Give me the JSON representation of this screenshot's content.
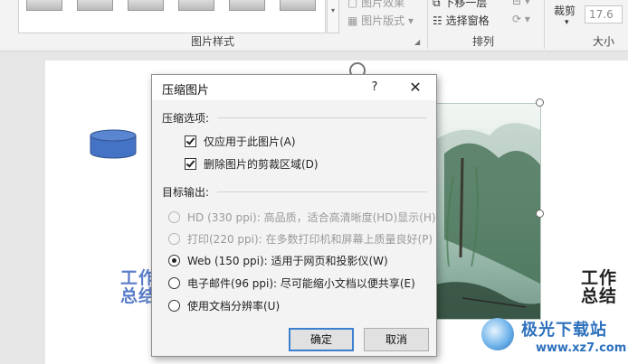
{
  "ribbon": {
    "picture_effects_label": "图片效果",
    "picture_layout_label": "图片版式",
    "bring_forward_label": "下移一层",
    "selection_pane_label": "选择窗格",
    "crop_label": "裁剪",
    "width_value": "17.6",
    "groups": {
      "picture_styles": "图片样式",
      "arrange": "排列",
      "size": "大小"
    }
  },
  "slide": {
    "text_left_line1": "工作",
    "text_left_line2": "总结",
    "text_right_line1": "工作",
    "text_right_line2": "总结"
  },
  "dialog": {
    "title": "压缩图片",
    "help": "?",
    "close": "✕",
    "compression_section": "压缩选项:",
    "compression_options": [
      {
        "label": "仅应用于此图片(A)",
        "checked": true
      },
      {
        "label": "删除图片的剪裁区域(D)",
        "checked": true
      }
    ],
    "target_section": "目标输出:",
    "target_options": [
      {
        "label": "HD (330 ppi): 高品质，适合高清晰度(HD)显示(H)",
        "selected": false,
        "disabled": true
      },
      {
        "label": "打印(220 ppi): 在多数打印机和屏幕上质量良好(P)",
        "selected": false,
        "disabled": true
      },
      {
        "label": "Web (150 ppi): 适用于网页和投影仪(W)",
        "selected": true,
        "disabled": false
      },
      {
        "label": "电子邮件(96 ppi): 尽可能缩小文档以便共享(E)",
        "selected": false,
        "disabled": false
      },
      {
        "label": "使用文档分辨率(U)",
        "selected": false,
        "disabled": false
      }
    ],
    "ok_label": "确定",
    "cancel_label": "取消"
  },
  "watermark": {
    "title": "极光下载站",
    "url": "www.xz7.com"
  },
  "colors": {
    "accent": "#3c7fd1",
    "cylinder_fill": "#4472c4",
    "watermark_blue": "#2d71bd"
  }
}
